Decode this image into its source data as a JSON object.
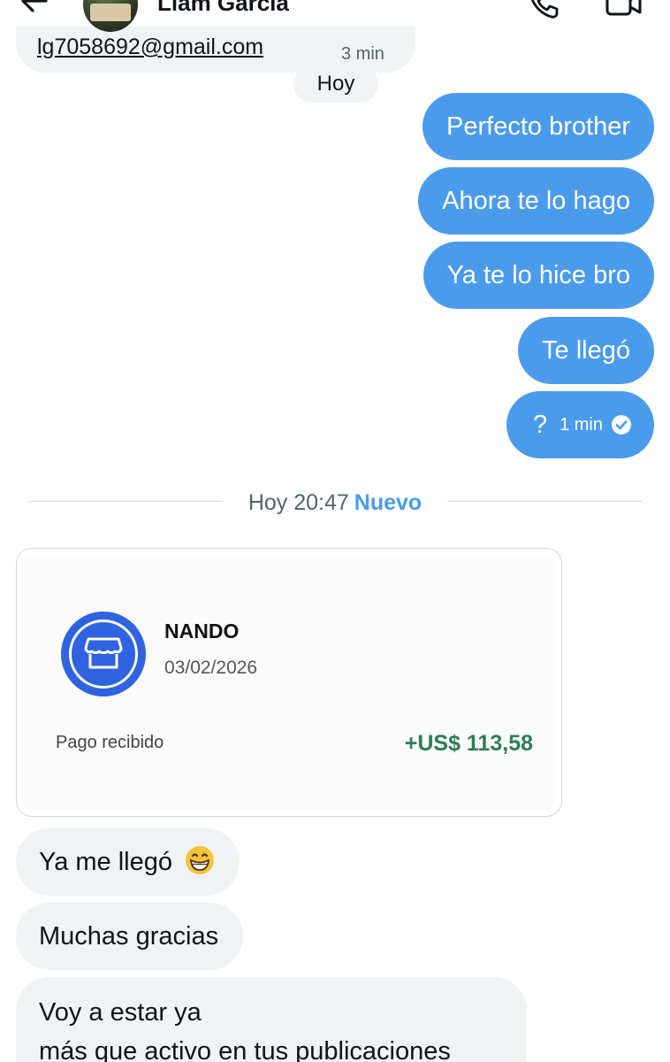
{
  "header": {
    "contact_name": "Liam García",
    "icons": [
      "back-arrow-icon",
      "avatar",
      "phone-icon",
      "video-call-icon"
    ]
  },
  "messages": {
    "cut_received": {
      "text": "lg7058692@gmail.com",
      "time": "3 min"
    },
    "day_label": "Hoy",
    "sent": [
      {
        "text": "Perfecto brother"
      },
      {
        "text": "Ahora te lo hago"
      },
      {
        "text": "Ya te lo hice bro"
      },
      {
        "text": "Te llegó"
      },
      {
        "text": "?",
        "time": "1 min",
        "status": "read-check-icon"
      }
    ],
    "divider": {
      "time": "Hoy 20:47",
      "new_label": "Nuevo"
    },
    "payment_card": {
      "payee": "NANDO",
      "date": "03/02/2026",
      "label": "Pago recibido",
      "amount": "+US$ 113,58",
      "icon": "store-icon"
    },
    "received": [
      {
        "text": "Ya me llegó",
        "emoji": "grinning-face-icon"
      },
      {
        "text": "Muchas gracias"
      },
      {
        "line1": "Voy a estar ya",
        "line2": "más que activo en tus publicaciones"
      }
    ]
  },
  "colors": {
    "sent_bubble": "#4b9bed",
    "received_bubble": "#eff3f4",
    "accent": "#4b9bed",
    "amount_green": "#2e7d52",
    "store_badge": "#2f63e0"
  }
}
